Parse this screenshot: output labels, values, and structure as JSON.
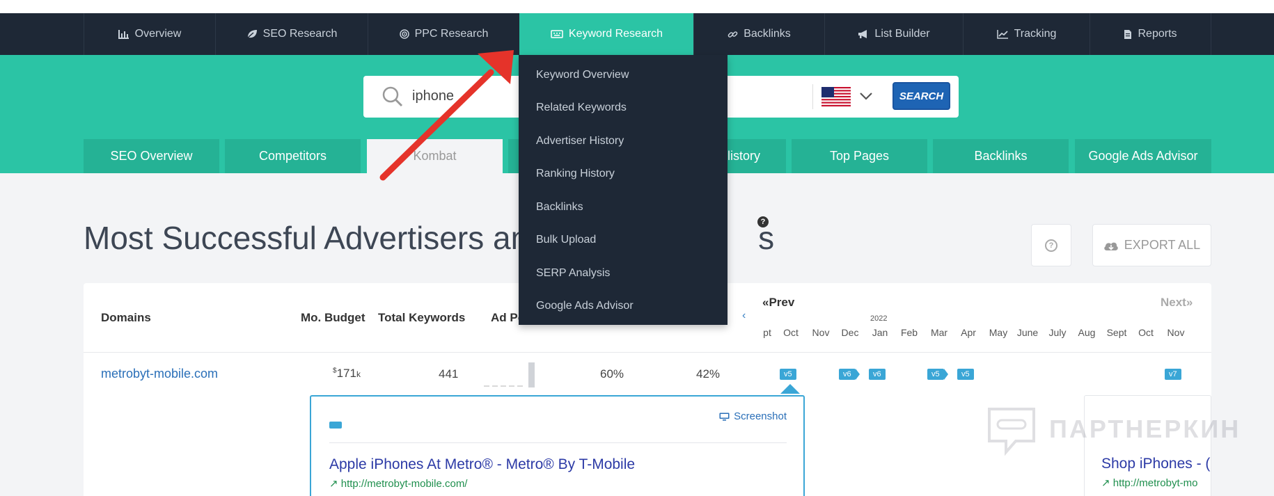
{
  "top_nav": {
    "items": [
      {
        "label": "Overview",
        "icon": "bar-chart-icon"
      },
      {
        "label": "SEO Research",
        "icon": "leaf-icon"
      },
      {
        "label": "PPC Research",
        "icon": "target-icon"
      },
      {
        "label": "Keyword Research",
        "icon": "keyboard-icon",
        "active": true
      },
      {
        "label": "Backlinks",
        "icon": "link-icon"
      },
      {
        "label": "List Builder",
        "icon": "megaphone-icon"
      },
      {
        "label": "Tracking",
        "icon": "line-chart-icon"
      },
      {
        "label": "Reports",
        "icon": "document-icon"
      }
    ]
  },
  "search": {
    "query": "iphone",
    "button_label": "SEARCH",
    "country_flag": "us-flag-icon"
  },
  "sub_tabs": [
    {
      "label": "SEO Overview"
    },
    {
      "label": "Competitors"
    },
    {
      "label": "Kombat",
      "active": true
    },
    {
      "label": ""
    },
    {
      "label": "listory"
    },
    {
      "label": "Top Pages"
    },
    {
      "label": "Backlinks"
    },
    {
      "label": "Google Ads Advisor"
    }
  ],
  "dropdown": {
    "items": [
      "Keyword Overview",
      "Related Keywords",
      "Advertiser History",
      "Ranking History",
      "Backlinks",
      "Bulk Upload",
      "SERP Analysis",
      "Google Ads Advisor"
    ]
  },
  "page": {
    "title_left": "Most Successful Advertisers an",
    "title_right": "s",
    "help_glyph": "?",
    "export_label": "EXPORT ALL"
  },
  "table": {
    "headers": {
      "domains": "Domains",
      "budget": "Mo. Budget",
      "total_keywords": "Total Keywords",
      "ad_position": "Ad Po"
    },
    "timeline": {
      "prev": "«Prev",
      "next": "Next»",
      "scroll_left": "‹",
      "year_label": "2022",
      "months": [
        "pt",
        "Oct",
        "Nov",
        "Dec",
        "Jan",
        "Feb",
        "Mar",
        "Apr",
        "May",
        "June",
        "July",
        "Aug",
        "Sept",
        "Oct",
        "Nov"
      ]
    },
    "row": {
      "domain": "metrobyt-mobile.com",
      "budget_currency": "$",
      "budget_value": "171",
      "budget_unit": "k",
      "total_keywords": "441",
      "pct_a": "60%",
      "pct_b": "42%",
      "badges": [
        "v5",
        "v6",
        "v6",
        "v5",
        "v5",
        "v7"
      ]
    }
  },
  "ad_popup": {
    "screenshot_label": "Screenshot",
    "title": "Apple iPhones At Metro® - Metro® By T-Mobile",
    "url": "http://metrobyt-mobile.com/"
  },
  "ad_popup_2": {
    "title": "Shop iPhones - (",
    "url": "http://metrobyt-mo"
  },
  "watermark": {
    "text": "ПАРТНЕРКИН"
  },
  "colors": {
    "nav_bg": "#1e2836",
    "accent_teal": "#2bc4a5",
    "search_button": "#1e64b4",
    "badge_blue": "#3aa6d6",
    "annotation_red": "#e5332a"
  }
}
